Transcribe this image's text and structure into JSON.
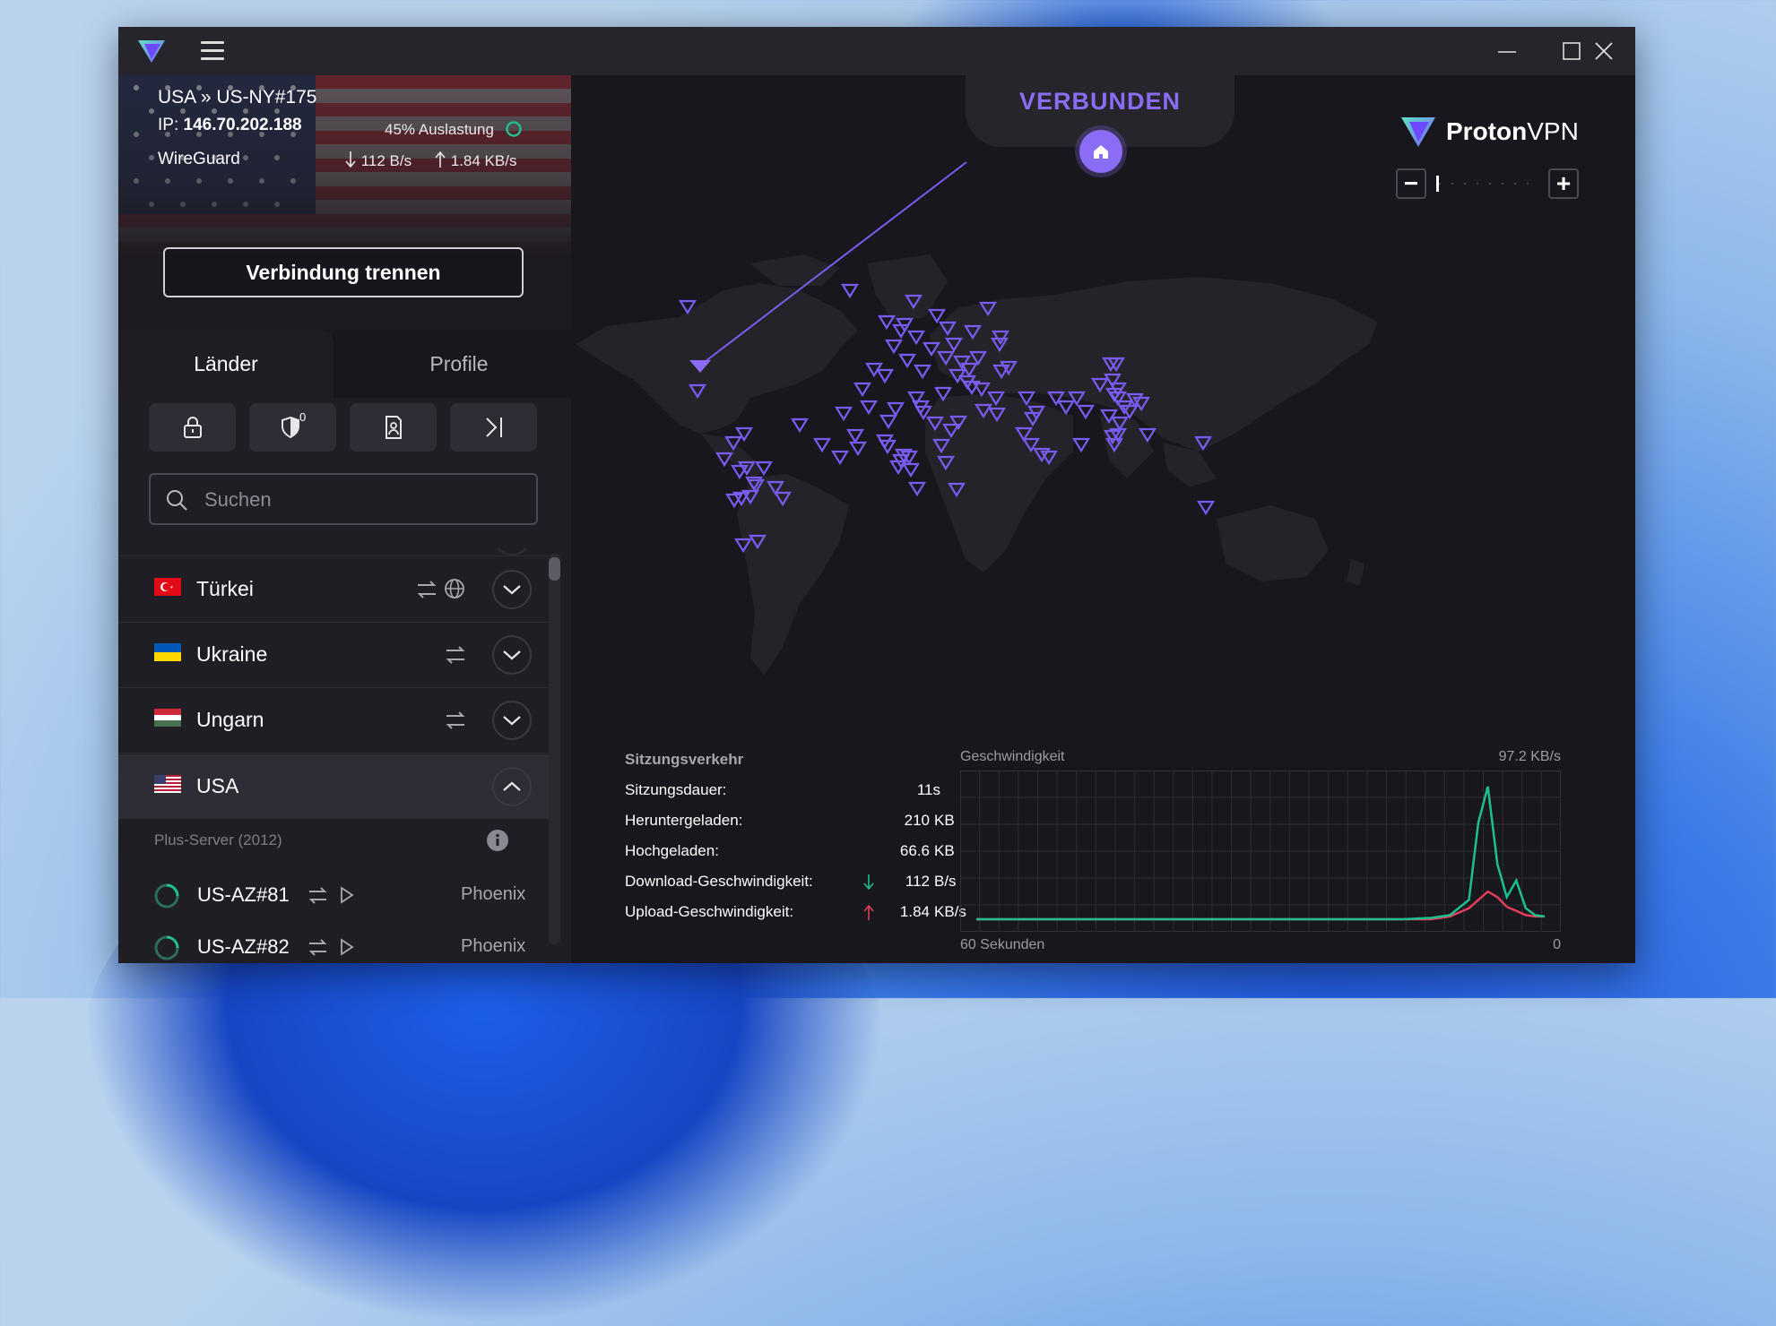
{
  "connection": {
    "route": "USA » US-NY#175",
    "ip_label": "IP:",
    "ip": "146.70.202.188",
    "load": "45% Auslastung",
    "protocol": "WireGuard",
    "down_speed": "112 B/s",
    "up_speed": "1.84 KB/s",
    "disconnect_label": "Verbindung trennen"
  },
  "tabs": [
    {
      "label": "Länder"
    },
    {
      "label": "Profile"
    }
  ],
  "filters": {
    "p2p_badge": "0"
  },
  "search": {
    "placeholder": "Suchen"
  },
  "countries": [
    {
      "name": "Türkei",
      "expanded": false
    },
    {
      "name": "Ukraine",
      "expanded": false
    },
    {
      "name": "Ungarn",
      "expanded": false
    },
    {
      "name": "USA",
      "expanded": true
    }
  ],
  "server_group": {
    "label": "Plus-Server (2012)"
  },
  "servers": [
    {
      "name": "US-AZ#81",
      "city": "Phoenix"
    },
    {
      "name": "US-AZ#82",
      "city": "Phoenix"
    }
  ],
  "map": {
    "status": "VERBUNDEN",
    "brand_a": "Proton",
    "brand_b": "VPN"
  },
  "session": {
    "title": "Sitzungsverkehr",
    "rows": [
      {
        "label": "Sitzungsdauer:",
        "value": "11s",
        "unit": ""
      },
      {
        "label": "Heruntergeladen:",
        "value": "210",
        "unit": "KB"
      },
      {
        "label": "Hochgeladen:",
        "value": "66.6",
        "unit": "KB"
      },
      {
        "label": "Download-Geschwindigkeit:",
        "value": "112",
        "unit": "B/s"
      },
      {
        "label": "Upload-Geschwindigkeit:",
        "value": "1.84",
        "unit": "KB/s"
      }
    ]
  },
  "speed_graph": {
    "title": "Geschwindigkeit",
    "max_label": "97.2  KB/s",
    "x_left_label": "60 Sekunden",
    "x_right_label": "0"
  },
  "chart_data": {
    "type": "line",
    "title": "Geschwindigkeit",
    "ylim": [
      0,
      97.2
    ],
    "x": [
      60,
      55,
      50,
      45,
      40,
      35,
      30,
      25,
      20,
      15,
      12,
      10,
      8,
      7,
      6,
      5,
      4,
      3,
      2,
      1,
      0
    ],
    "series": [
      {
        "color": "#1fbf8f",
        "values": [
          0,
          0,
          0,
          0,
          0,
          0,
          0,
          0,
          0,
          0,
          1,
          3,
          14,
          70,
          96,
          40,
          16,
          28,
          8,
          3,
          2
        ]
      },
      {
        "color": "#e0405a",
        "values": [
          0,
          0,
          0,
          0,
          0,
          0,
          0,
          0,
          0,
          0,
          0,
          2,
          8,
          14,
          20,
          16,
          9,
          6,
          3,
          2,
          2
        ]
      }
    ]
  },
  "colors": {
    "accent": "#8a6cf5",
    "download": "#1fbf8f",
    "upload": "#e0405a"
  }
}
